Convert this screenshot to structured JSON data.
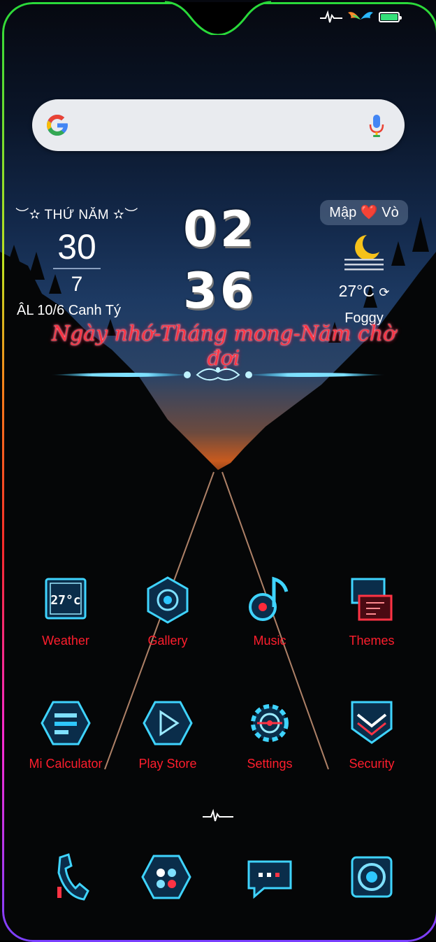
{
  "status_bar": {
    "icons": [
      "heartbeat-icon",
      "wings-icon",
      "battery-charging-icon"
    ],
    "battery_color": "#36e07a"
  },
  "search_bar": {
    "logo": "google-g-icon",
    "mic": "microphone-icon"
  },
  "date_widget": {
    "weekday": "THỨ NĂM",
    "day": "30",
    "month": "7",
    "lunar": "ÂL 10/6 Canh Tý"
  },
  "clock": {
    "hours": "02",
    "minutes": "36"
  },
  "nickname_badge": {
    "left": "Mập",
    "right": "Vò",
    "heart_icon": "heart-icon"
  },
  "weather_widget": {
    "icon": "moon-fog-icon",
    "temperature": "27°C",
    "condition": "Foggy",
    "refresh_icon": "refresh-icon"
  },
  "motto": "Ngày nhớ-Tháng mong-Năm chờ đợi",
  "apps": [
    {
      "label": "Weather",
      "icon": "weather-app-icon",
      "badge": "27°c"
    },
    {
      "label": "Gallery",
      "icon": "gallery-app-icon"
    },
    {
      "label": "Music",
      "icon": "music-app-icon"
    },
    {
      "label": "Themes",
      "icon": "themes-app-icon"
    },
    {
      "label": "Mi Calculator",
      "icon": "calculator-app-icon"
    },
    {
      "label": "Play Store",
      "icon": "play-store-app-icon"
    },
    {
      "label": "Settings",
      "icon": "settings-app-icon"
    },
    {
      "label": "Security",
      "icon": "security-app-icon"
    }
  ],
  "dock": [
    {
      "icon": "phone-app-icon"
    },
    {
      "icon": "contacts-app-icon"
    },
    {
      "icon": "messages-app-icon"
    },
    {
      "icon": "camera-app-icon"
    }
  ],
  "colors": {
    "label": "#ff1e2d",
    "neon": "#2ec8ff",
    "border_gradient": [
      "#29d93a",
      "#ff7a1a",
      "#ff2a2a",
      "#ff2bd0",
      "#7a40ff"
    ]
  }
}
